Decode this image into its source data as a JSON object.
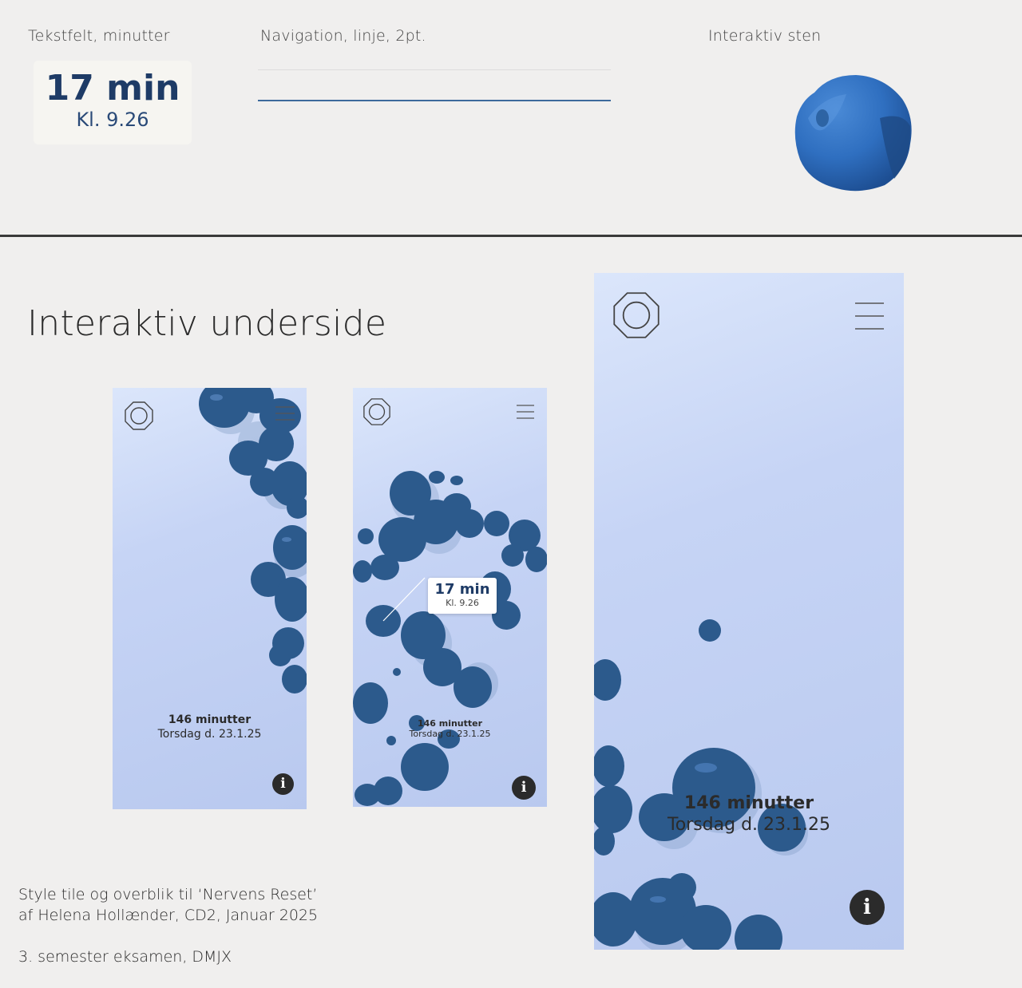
{
  "top": {
    "textfield_caption": "Tekstfelt, minutter",
    "navigation_caption": "Navigation, linje, 2pt.",
    "stone_caption": "Interaktiv sten",
    "textfield_minutes": "17 min",
    "textfield_time": "Kl. 9.26"
  },
  "section": {
    "title": "Interaktiv underside"
  },
  "screens": {
    "screen1": {
      "minutes": "146 minutter",
      "date": "Torsdag d. 23.1.25",
      "info": "i"
    },
    "screen2": {
      "minutes": "146 minutter",
      "date": "Torsdag d. 23.1.25",
      "info": "i",
      "callout_minutes": "17 min",
      "callout_time": "Kl. 9.26"
    },
    "screen3": {
      "minutes": "146 minutter",
      "date": "Torsdag d. 23.1.25",
      "info": "i"
    }
  },
  "footer": {
    "line1": "Style tile og overblik til ‘Nervens Reset’",
    "line2": "af Helena Hollænder, CD2, Januar 2025",
    "line3": "3. semester eksamen, DMJX"
  },
  "colors": {
    "stone": "#2c5a8c",
    "stone_highlight": "#3b78c4",
    "accent_line": "#3d6a9c",
    "text_dark": "#2b2b2b",
    "screen_bg_top": "#dbe6fb",
    "screen_bg_bottom": "#b9c9ef"
  },
  "icons": [
    "logo-octagon-icon",
    "hamburger-menu-icon",
    "info-icon",
    "stone-icon"
  ]
}
